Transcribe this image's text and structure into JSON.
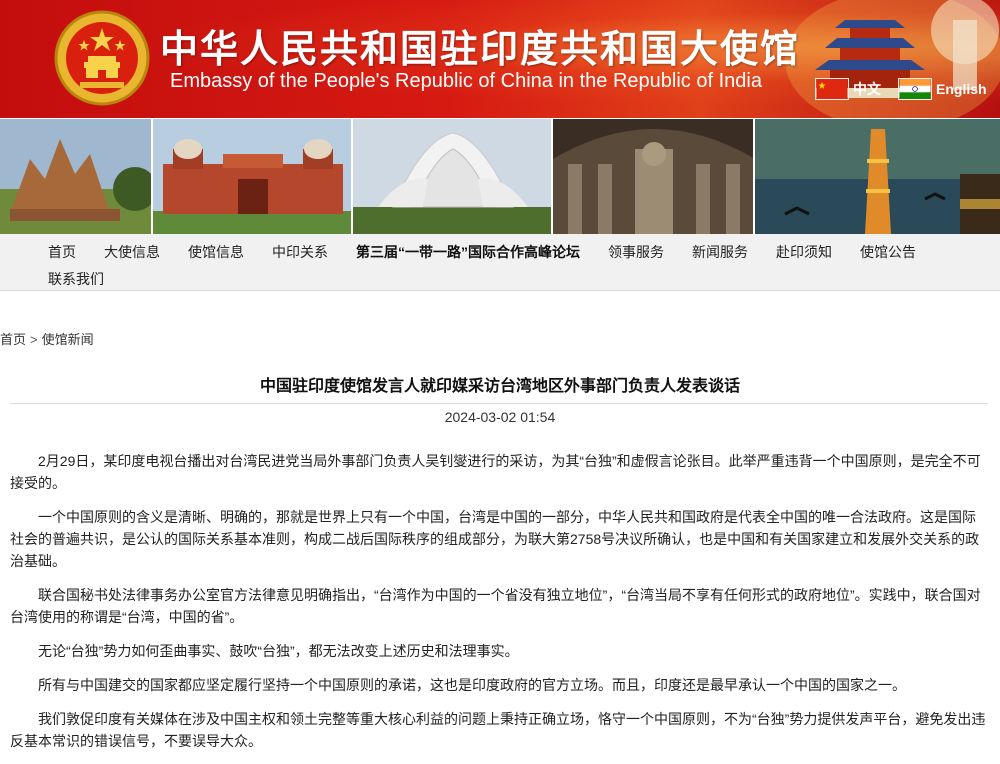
{
  "header": {
    "title_cn": "中华人民共和国驻印度共和国大使馆",
    "title_en": "Embassy of the People's Republic of China in the Republic of India",
    "lang_cn": "中文",
    "lang_en": "English",
    "colors": {
      "banner_red": "#c30d0d",
      "gold": "#f6c343"
    }
  },
  "nav": {
    "row1": [
      "首页",
      "大使信息",
      "使馆信息",
      "中印关系",
      "第三届“一带一路”国际合作高峰论坛",
      "领事服务",
      "新闻服务",
      "赴印须知",
      "使馆公告"
    ],
    "row2": [
      "联系我们"
    ]
  },
  "breadcrumb": {
    "home": "首页",
    "separator": ">",
    "section": "使馆新闻"
  },
  "article": {
    "title": "中国驻印度使馆发言人就印媒采访台湾地区外事部门负责人发表谈话",
    "date": "2024-03-02 01:54",
    "paragraphs": [
      "2月29日，某印度电视台播出对台湾民进党当局外事部门负责人吴钊燮进行的采访，为其“台独”和虚假言论张目。此举严重违背一个中国原则，是完全不可接受的。",
      "一个中国原则的含义是清晰、明确的，那就是世界上只有一个中国，台湾是中国的一部分，中华人民共和国政府是代表全中国的唯一合法政府。这是国际社会的普遍共识，是公认的国际关系基本准则，构成二战后国际秩序的组成部分，为联大第2758号决议所确认，也是中国和有关国家建立和发展外交关系的政治基础。",
      "联合国秘书处法律事务办公室官方法律意见明确指出，“台湾作为中国的一个省没有独立地位”，“台湾当局不享有任何形式的政府地位”。实践中，联合国对台湾使用的称谓是“台湾，中国的省”。",
      "无论“台独”势力如何歪曲事实、鼓吹“台独”，都无法改变上述历史和法理事实。",
      "所有与中国建交的国家都应坚定履行坚持一个中国原则的承诺，这也是印度政府的官方立场。而且，印度还是最早承认一个中国的国家之一。",
      "我们敦促印度有关媒体在涉及中国主权和领土完整等重大核心利益的问题上秉持正确立场，恪守一个中国原则，不为“台独”势力提供发声平台，避免发出违反基本常识的错误信号，不要误导大众。"
    ]
  },
  "photos": [
    "temple-photo",
    "red-fort-photo",
    "lotus-temple-photo",
    "cave-temple-photo",
    "qutub-minar-photo"
  ]
}
